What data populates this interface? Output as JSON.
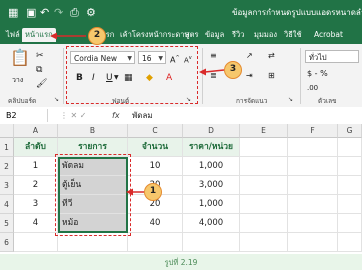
{
  "titlebar": {
    "doc_title": "ข้อมูลการกำหนดรูปแบบแอดรหนาดลำดับ"
  },
  "tabs": [
    {
      "label": "ไฟล์"
    },
    {
      "label": "หน้าแรก"
    },
    {
      "label": "แทรก"
    },
    {
      "label": "เค้าโครงหน้ากระดาษ"
    },
    {
      "label": "สูตร"
    },
    {
      "label": "ข้อมูล"
    },
    {
      "label": "รีวิว"
    },
    {
      "label": "มุมมอง"
    },
    {
      "label": "วิธีใช้"
    },
    {
      "label": "Acrobat"
    }
  ],
  "ribbon": {
    "clipboard_label": "คลิปบอร์ด",
    "paste_label": "วาง",
    "font_name": "Cordia New",
    "font_size": "16",
    "bold": "B",
    "italic": "I",
    "underline": "U",
    "font_group_label": "ฟอนต์",
    "alignment_label": "การจัดแนว",
    "number_format": "ทั่วไป",
    "currency": "$ - %",
    "number_label": "ตัวเลข"
  },
  "formula_bar": {
    "name_box": "B2",
    "fx": "fx",
    "value": "พัดลม"
  },
  "columns": [
    "A",
    "B",
    "C",
    "D",
    "E",
    "F",
    "G"
  ],
  "rows": [
    "1",
    "2",
    "3",
    "4",
    "5",
    "6"
  ],
  "table": {
    "headers": [
      "ลำดับ",
      "รายการ",
      "จำนวน",
      "ราคา/หน่วย"
    ],
    "rows": [
      [
        "1",
        "พัดลม",
        "10",
        "1,000"
      ],
      [
        "2",
        "ตู้เย็น",
        "20",
        "3,000"
      ],
      [
        "3",
        "ทีวี",
        "20",
        "1,000"
      ],
      [
        "4",
        "หม้อ",
        "40",
        "4,000"
      ]
    ]
  },
  "callouts": [
    "1",
    "2",
    "3"
  ],
  "caption": "รูปที่ 2.19",
  "colors": {
    "excel_green": "#217346",
    "highlight_red": "#d92a2a",
    "callout_fill": "#f6c76c"
  }
}
